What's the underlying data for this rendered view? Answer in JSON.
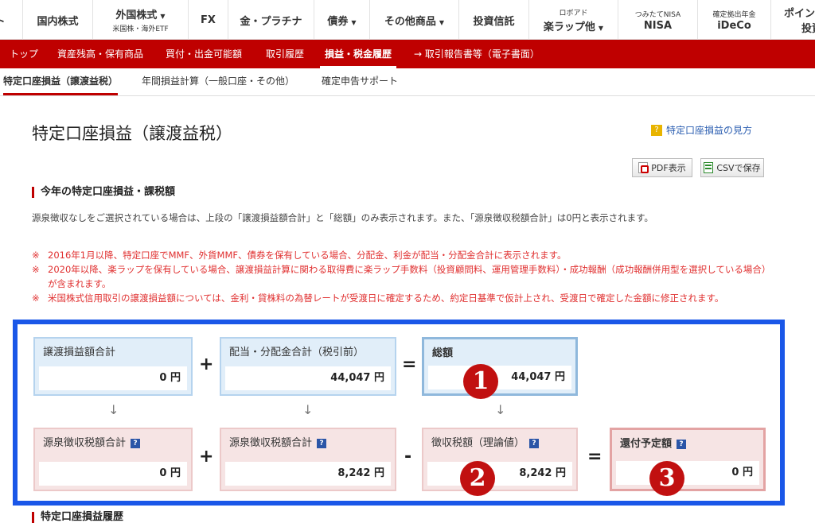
{
  "topnav": [
    {
      "label": "ト"
    },
    {
      "label": "国内株式"
    },
    {
      "label": "外国株式",
      "sub": "米国株・海外ETF",
      "caret": "▼"
    },
    {
      "label": "FX"
    },
    {
      "label": "金・プラチナ"
    },
    {
      "label": "債券",
      "caret": "▼"
    },
    {
      "label": "その他商品",
      "caret": "▼"
    },
    {
      "label": "投資信託"
    },
    {
      "top": "ロボアド",
      "label": "楽ラップ他",
      "caret": "▼"
    },
    {
      "top": "つみたてNISA",
      "label": "NISA"
    },
    {
      "top": "確定拠出年金",
      "label": "iDeCo"
    },
    {
      "label": "ポイン",
      "sub": "投資"
    }
  ],
  "redbar": [
    "トップ",
    "資産残高・保有商品",
    "買付・出金可能額",
    "取引履歴",
    "損益・税金履歴",
    "→ 取引報告書等（電子書面）"
  ],
  "subtabs": [
    "特定口座損益（譲渡益税）",
    "年間損益計算（一般口座・その他）",
    "確定申告サポート"
  ],
  "page_title": "特定口座損益（譲渡益税）",
  "help_link": "特定口座損益の見方",
  "buttons": {
    "pdf": "PDF表示",
    "csv": "CSVで保存"
  },
  "section_heading": "今年の特定口座損益・課税額",
  "description": "源泉徴収なしをご選択されている場合は、上段の「譲渡損益額合計」と「総額」のみ表示されます。また、「源泉徴収税額合計」は0円と表示されます。",
  "notes": [
    "2016年1月以降、特定口座でMMF、外貨MMF、債券を保有している場合、分配金、利金が配当・分配金合計に表示されます。",
    "2020年以降、楽ラップを保有している場合、譲渡損益計算に関わる取得費に楽ラップ手数料（投資顧問料、運用管理手数料）・成功報酬（成功報酬併用型を選択している場合）が含まれます。",
    "米国株式信用取引の譲渡損益額については、金利・貸株料の為替レートが受渡日に確定するため、約定日基準で仮計上され、受渡日で確定した金額に修正されます。"
  ],
  "note_mark": "※",
  "summary": {
    "row1": [
      {
        "label": "譲渡損益額合計",
        "value": "0 円"
      },
      {
        "label": "配当・分配金合計（税引前）",
        "value": "44,047 円"
      },
      {
        "label": "総額",
        "value": "44,047 円"
      }
    ],
    "row2": [
      {
        "label": "源泉徴収税額合計",
        "value": "0 円"
      },
      {
        "label": "源泉徴収税額合計",
        "value": "8,242 円"
      },
      {
        "label": "徴収税額（理論値）",
        "value": "8,242 円"
      },
      {
        "label": "還付予定額",
        "value": "0 円"
      }
    ],
    "ops": {
      "plus": "+",
      "equals": "=",
      "minus": "-",
      "arrow": "↓",
      "help": "?"
    },
    "markers": [
      "1",
      "2",
      "3"
    ]
  },
  "bottom_heading": "特定口座損益履歴"
}
